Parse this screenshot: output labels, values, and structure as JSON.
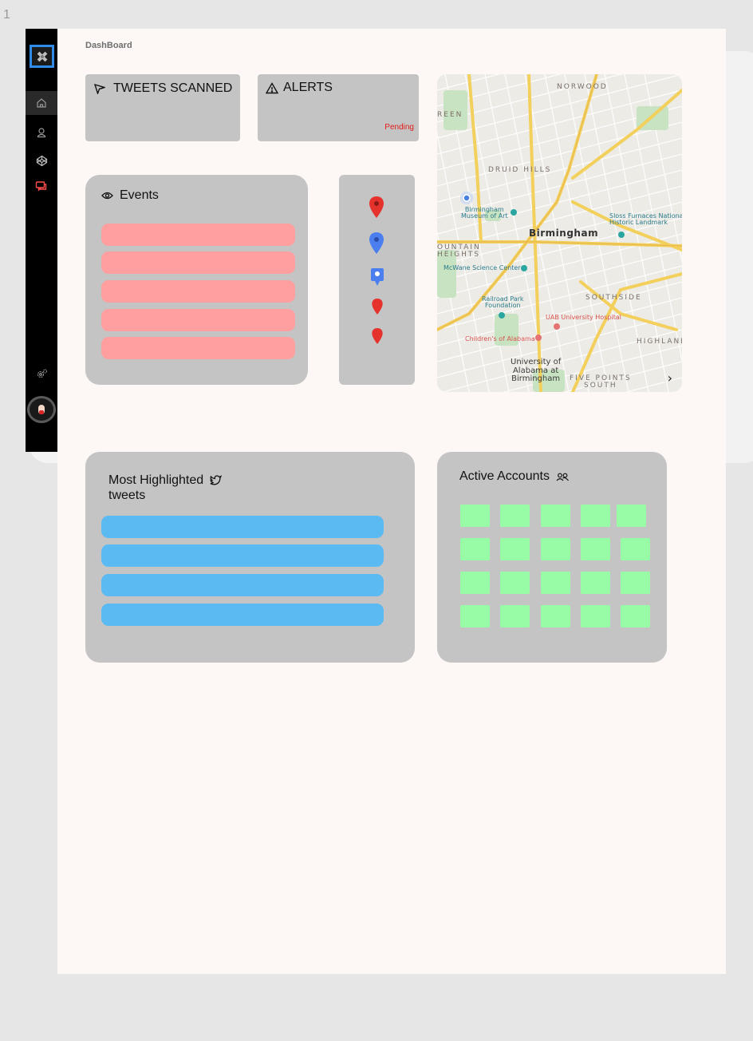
{
  "frame_number": "1",
  "page_title": "DashBoard",
  "sidebar": {
    "logo_icon": "logo-icon",
    "items": [
      {
        "icon": "home-icon",
        "active": true
      },
      {
        "icon": "user-icon",
        "active": false
      },
      {
        "icon": "codepen-icon",
        "active": false
      },
      {
        "icon": "chat-icon",
        "active": false,
        "color": "#ff4d4d"
      }
    ],
    "settings_icon": "settings-icon",
    "avatar_icon": "avatar"
  },
  "stats": {
    "tweets_scanned": {
      "label": "TWEETS SCANNED",
      "icon": "send-icon"
    },
    "alerts": {
      "label": "ALERTS",
      "icon": "alert-triangle-icon",
      "status": "Pending",
      "status_color": "#e31b1b"
    }
  },
  "events": {
    "title": "Events",
    "icon": "eye-icon",
    "row_count": 5,
    "row_color": "#ff9f9f"
  },
  "markers": [
    {
      "icon": "map-pin-red-icon"
    },
    {
      "icon": "map-pin-blue-icon"
    },
    {
      "icon": "map-pin-square-blue-icon"
    },
    {
      "icon": "map-pin-red-small-icon"
    },
    {
      "icon": "map-pin-red-small-icon"
    }
  ],
  "map": {
    "labels": {
      "norwood": "NORWOOD",
      "reen": "REEN",
      "druid_hills": "DRUID HILLS",
      "birmingham": "Birmingham",
      "museum": "Birmingham\nMuseum of Art",
      "sloss": "Sloss Furnaces National\nHistoric Landmark",
      "fountain_heights": "OUNTAIN\nHEIGHTS",
      "mcwane": "McWane Science Center",
      "southside": "SOUTHSIDE",
      "railroad_park": "Railroad Park\nFoundation",
      "uab_hospital": "UAB University Hospital",
      "childrens": "Children's of Alabama",
      "highland": "HIGHLAND",
      "university": "University of\nAlabama at\nBirmingham",
      "five_points": "FIVE POINTS\nSOUTH"
    },
    "road_color": "#f3cf5c",
    "next_icon": "chevron-right-icon"
  },
  "highlighted": {
    "title": "Most Highlighted\ntweets",
    "icon": "twitter-icon",
    "row_count": 4,
    "row_color": "#5bbaf2"
  },
  "accounts": {
    "title": "Active Accounts",
    "icon": "users-icon",
    "rows": 4,
    "cols": 5,
    "tile_color": "#98fba6"
  }
}
